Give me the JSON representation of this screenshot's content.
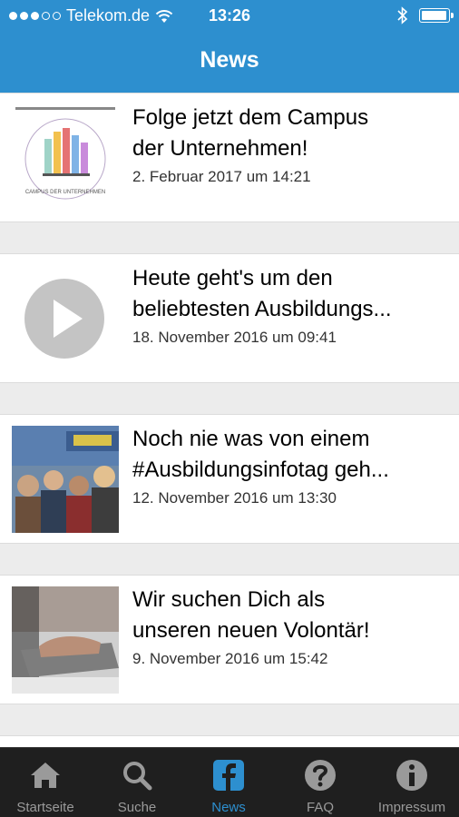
{
  "status_bar": {
    "carrier": "Telekom.de",
    "time": "13:26",
    "signal_filled": 3,
    "signal_total": 5,
    "battery_level": 0.95
  },
  "header": {
    "title": "News"
  },
  "news": [
    {
      "headline": "Folge jetzt dem Campus der Unternehmen!",
      "line1": "Folge jetzt dem Campus",
      "line2": "der Unternehmen!",
      "date": "2. Februar 2017 um 14:21",
      "thumb": "campus-logo"
    },
    {
      "headline": "Heute geht's um den beliebtesten Ausbildungs...",
      "line1": "Heute geht's um den",
      "line2": "beliebtesten Ausbildungs...",
      "date": "18. November 2016 um 09:41",
      "thumb": "video-play"
    },
    {
      "headline": "Noch nie was von einem #Ausbildungsinfotag geh...",
      "line1": "Noch nie was von einem",
      "line2": "#Ausbildungsinfotag geh...",
      "date": "12. November 2016 um 13:30",
      "thumb": "crowd-photo"
    },
    {
      "headline": "Wir suchen Dich als unseren neuen Volontär!",
      "line1": "Wir suchen Dich als",
      "line2": "unseren neuen Volontär!",
      "date": "9. November 2016 um 15:42",
      "thumb": "laptop-photo"
    }
  ],
  "tabs": [
    {
      "label": "Startseite",
      "icon": "home-icon",
      "active": false
    },
    {
      "label": "Suche",
      "icon": "search-icon",
      "active": false
    },
    {
      "label": "News",
      "icon": "facebook-icon",
      "active": true
    },
    {
      "label": "FAQ",
      "icon": "question-icon",
      "active": false
    },
    {
      "label": "Impressum",
      "icon": "info-icon",
      "active": false
    }
  ],
  "colors": {
    "accent": "#2d8fcf",
    "tabbar": "#1f1f1f",
    "inactive": "#9a9a9a"
  },
  "campus_logo_text": "CAMPUS DER UNTERNEHMEN"
}
